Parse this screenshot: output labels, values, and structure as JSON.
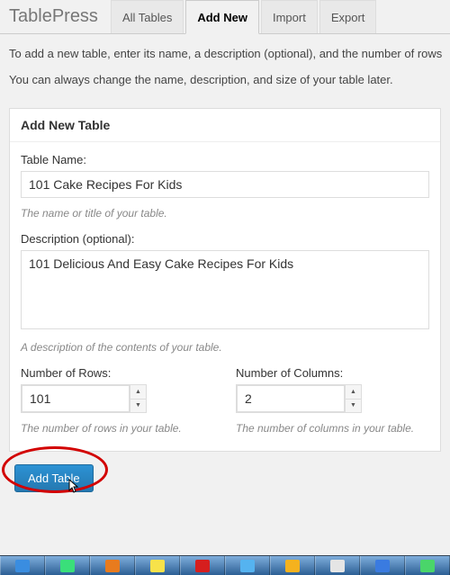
{
  "plugin_name": "TablePress",
  "tabs": [
    {
      "label": "All Tables",
      "active": false
    },
    {
      "label": "Add New",
      "active": true
    },
    {
      "label": "Import",
      "active": false
    },
    {
      "label": "Export",
      "active": false
    }
  ],
  "intro": {
    "line1": "To add a new table, enter its name, a description (optional), and the number of rows",
    "line2": "You can always change the name, description, and size of your table later."
  },
  "postbox_title": "Add New Table",
  "fields": {
    "name": {
      "label": "Table Name:",
      "value": "101 Cake Recipes For Kids",
      "hint": "The name or title of your table."
    },
    "description": {
      "label": "Description (optional):",
      "value": "101 Delicious And Easy Cake Recipes For Kids",
      "hint": "A description of the contents of your table."
    },
    "rows": {
      "label": "Number of Rows:",
      "value": "101",
      "hint": "The number of rows in your table."
    },
    "cols": {
      "label": "Number of Columns:",
      "value": "2",
      "hint": "The number of columns in your table."
    }
  },
  "submit_label": "Add Table",
  "taskbar_colors": [
    "#3a8de0",
    "#3adf7a",
    "#e87b1e",
    "#f7e24a",
    "#d61e1e",
    "#55b3f0",
    "#f5b21e",
    "#e5e5e5",
    "#3a7be0",
    "#4ad56a"
  ]
}
